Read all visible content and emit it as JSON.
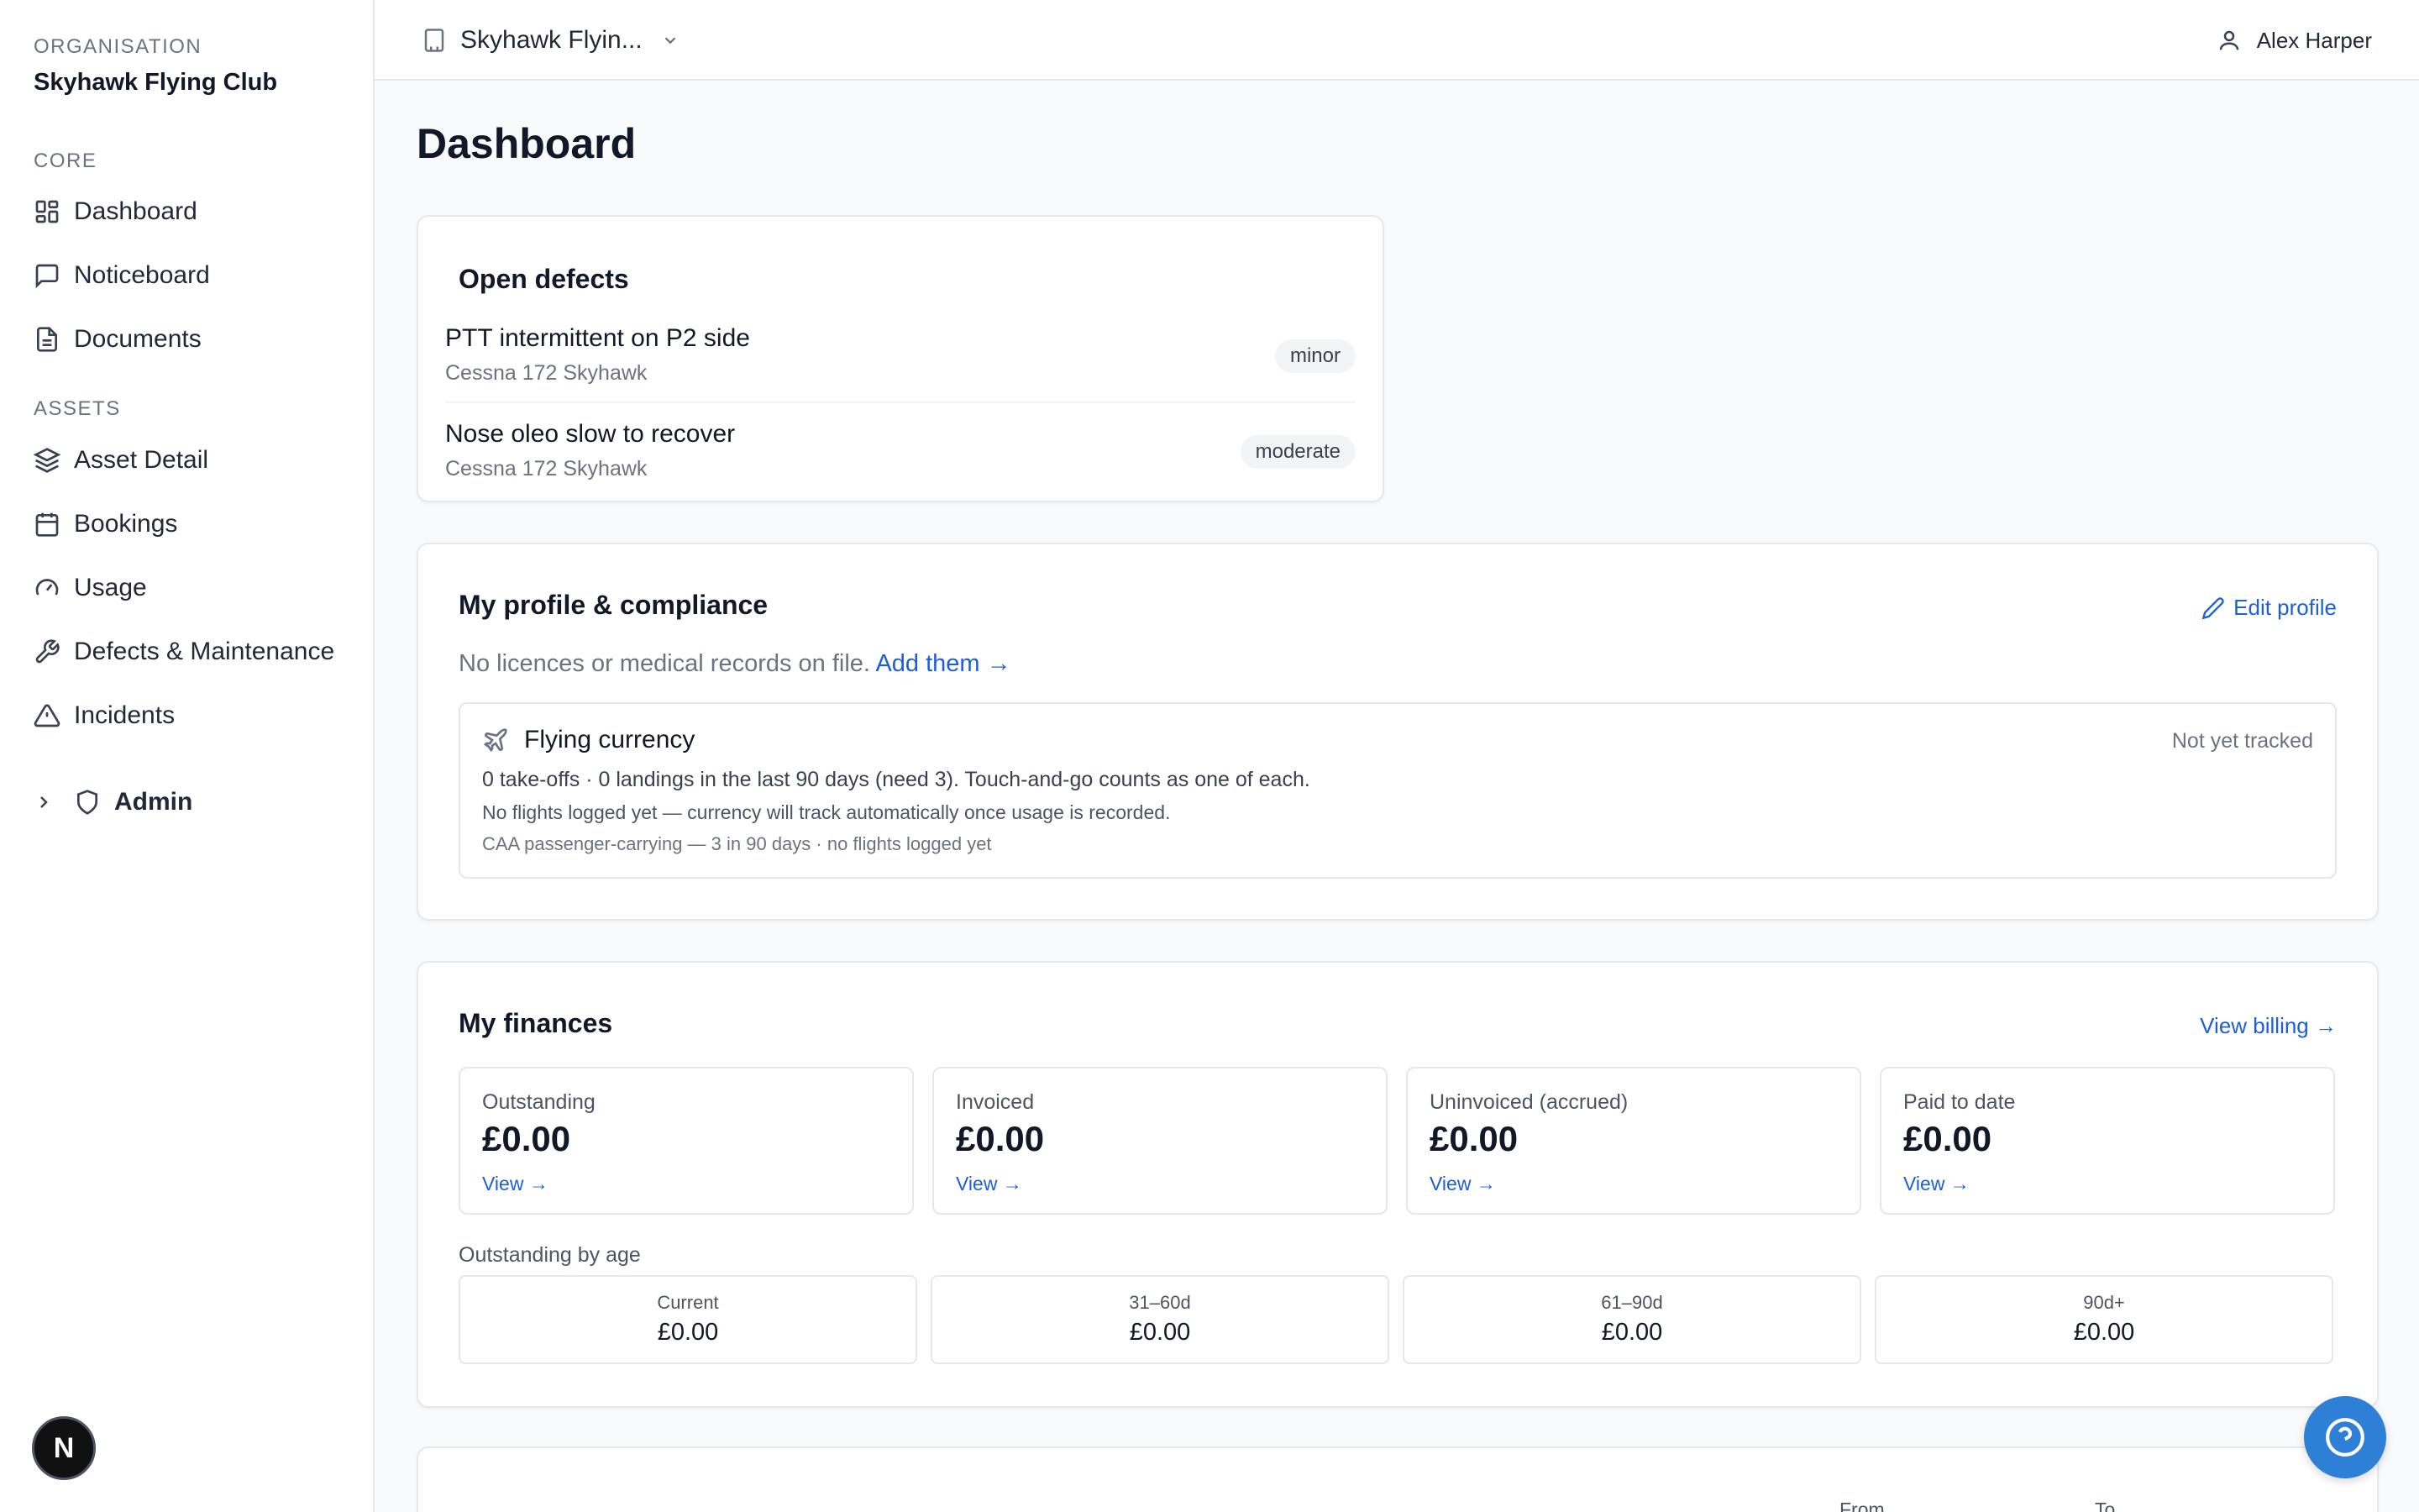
{
  "sidebar": {
    "org_label": "ORGANISATION",
    "org_name": "Skyhawk Flying Club",
    "core_label": "CORE",
    "assets_label": "ASSETS",
    "items": {
      "dashboard": "Dashboard",
      "noticeboard": "Noticeboard",
      "documents": "Documents",
      "asset_detail": "Asset Detail",
      "bookings": "Bookings",
      "usage": "Usage",
      "defects": "Defects & Maintenance",
      "incidents": "Incidents",
      "admin": "Admin"
    },
    "dev_badge": "N"
  },
  "topbar": {
    "org_switcher": "Skyhawk Flyin...",
    "user_name": "Alex Harper"
  },
  "page": {
    "title": "Dashboard"
  },
  "open_defects": {
    "title": "Open defects",
    "items": [
      {
        "title": "PTT intermittent on P2 side",
        "aircraft": "Cessna 172 Skyhawk",
        "severity": "minor"
      },
      {
        "title": "Nose oleo slow to recover",
        "aircraft": "Cessna 172 Skyhawk",
        "severity": "moderate"
      }
    ]
  },
  "profile": {
    "title": "My profile & compliance",
    "edit_label": "Edit profile",
    "no_records": "No licences or medical records on file.",
    "add_link": "Add them →",
    "currency": {
      "title": "Flying currency",
      "status": "Not yet tracked",
      "line1": "0 take-offs · 0 landings in the last 90 days (need 3). Touch-and-go counts as one of each.",
      "line2": "No flights logged yet — currency will track automatically once usage is recorded.",
      "line3": "CAA passenger-carrying — 3 in 90 days · no flights logged yet"
    }
  },
  "finances": {
    "title": "My finances",
    "view_billing": "View billing →",
    "stats": [
      {
        "label": "Outstanding",
        "value": "£0.00",
        "link": "View →"
      },
      {
        "label": "Invoiced",
        "value": "£0.00",
        "link": "View →"
      },
      {
        "label": "Uninvoiced (accrued)",
        "value": "£0.00",
        "link": "View →"
      },
      {
        "label": "Paid to date",
        "value": "£0.00",
        "link": "View →"
      }
    ],
    "age_title": "Outstanding by age",
    "age_buckets": [
      {
        "label": "Current",
        "value": "£0.00"
      },
      {
        "label": "31–60d",
        "value": "£0.00"
      },
      {
        "label": "61–90d",
        "value": "£0.00"
      },
      {
        "label": "90d+",
        "value": "£0.00"
      }
    ]
  },
  "bottom_card": {
    "col_from": "From",
    "col_to": "To"
  },
  "colors": {
    "accent": "#1d5fd6",
    "help_button": "#2e7fd6",
    "border": "#e5e7eb"
  }
}
